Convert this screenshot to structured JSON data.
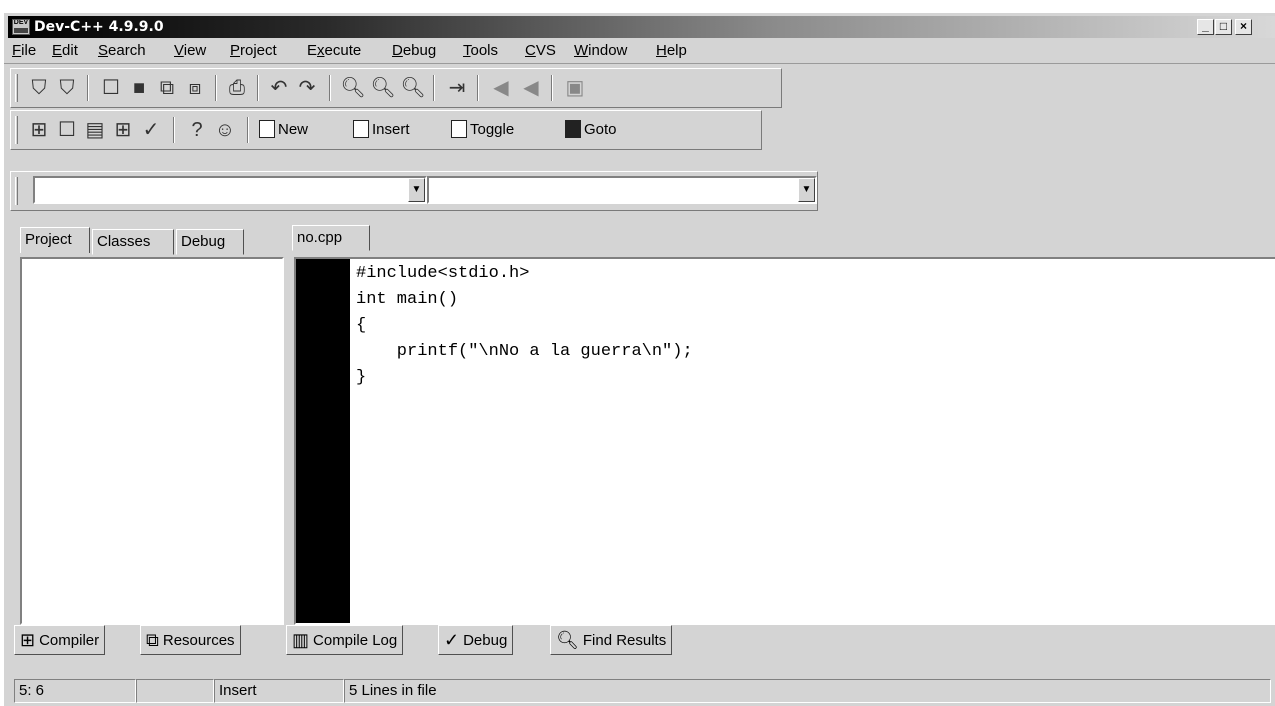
{
  "window": {
    "title": "Dev-C++ 4.9.9.0"
  },
  "title_buttons": {
    "minimize": "_",
    "maximize": "□",
    "close": "×"
  },
  "menu": [
    {
      "label": "File",
      "u": "F",
      "rest": "ile"
    },
    {
      "label": "Edit",
      "u": "E",
      "rest": "dit"
    },
    {
      "label": "Search",
      "u": "S",
      "rest": "earch"
    },
    {
      "label": "View",
      "u": "V",
      "rest": "iew"
    },
    {
      "label": "Project",
      "u": "P",
      "rest": "roject"
    },
    {
      "label": "Execute",
      "pre": "E",
      "u": "x",
      "rest": "ecute"
    },
    {
      "label": "Debug",
      "u": "D",
      "rest": "ebug"
    },
    {
      "label": "Tools",
      "u": "T",
      "rest": "ools"
    },
    {
      "label": "CVS",
      "u": "C",
      "rest": "VS"
    },
    {
      "label": "Window",
      "u": "W",
      "rest": "indow"
    },
    {
      "label": "Help",
      "u": "H",
      "rest": "elp"
    }
  ],
  "toolbar2": {
    "new": "New",
    "insert": "Insert",
    "toggle": "Toggle",
    "goto": "Goto"
  },
  "left_tabs": [
    "Project",
    "Classes",
    "Debug"
  ],
  "editor": {
    "tab": "no.cpp",
    "code": "#include<stdio.h>\nint main()\n{\n    printf(\"\\nNo a la guerra\\n\");\n}"
  },
  "bottom_tabs": [
    "Compiler",
    "Resources",
    "Compile Log",
    "Debug",
    "Find Results"
  ],
  "status": {
    "position": "5: 6",
    "mode": "Insert",
    "lines": "5 Lines in file"
  },
  "colors": {
    "face": "#d4d4d4",
    "gutter": "#000000"
  }
}
